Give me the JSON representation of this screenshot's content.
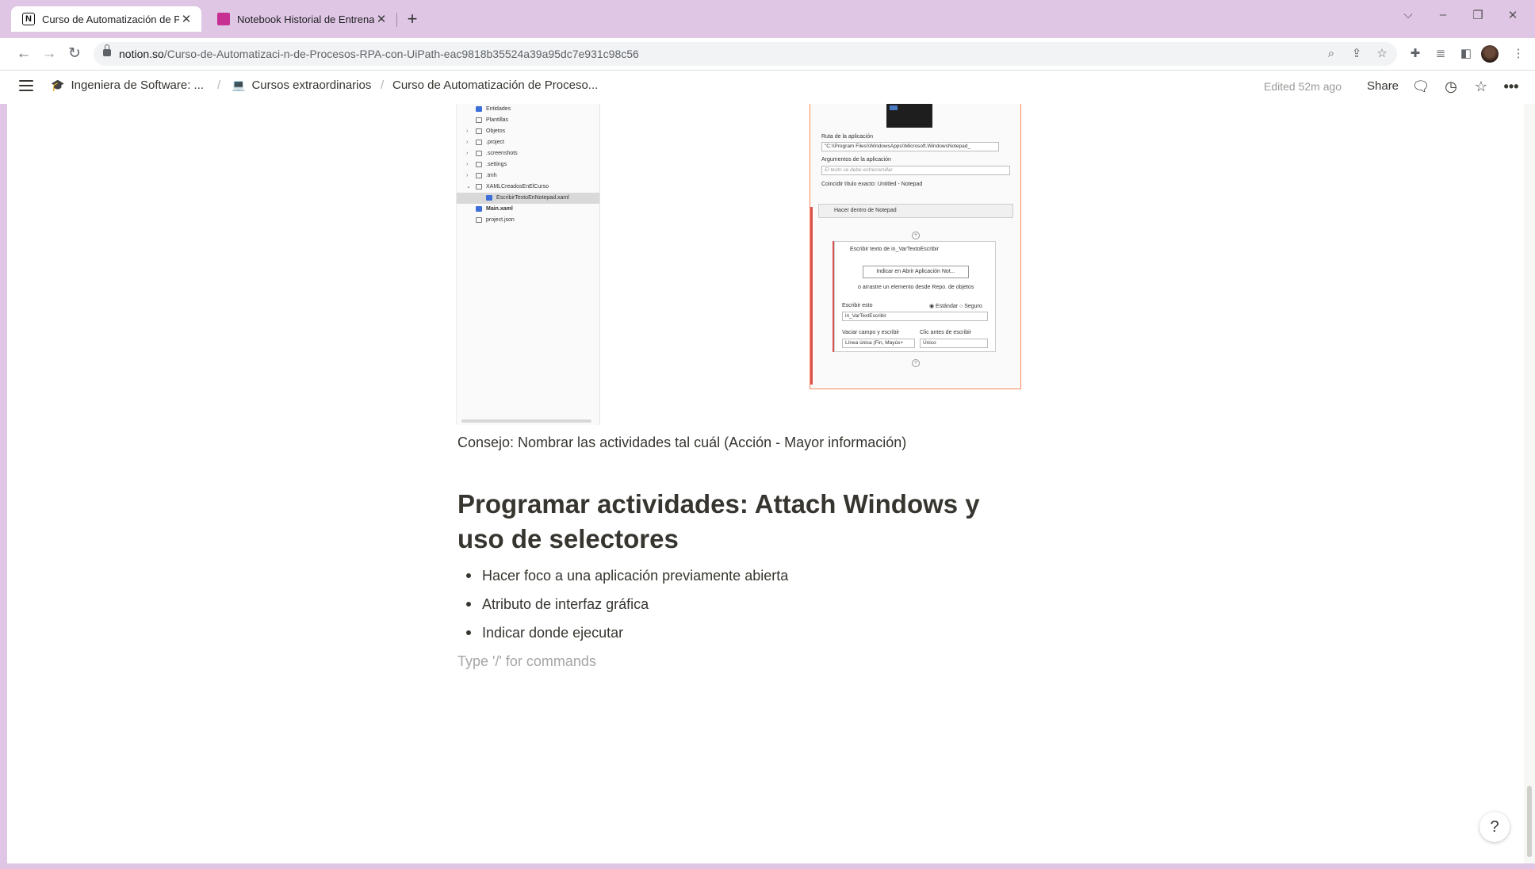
{
  "browser": {
    "tabs": [
      {
        "title": "Curso de Automatización de Proc",
        "active": true,
        "favicon": "notion-icon"
      },
      {
        "title": "Notebook Historial de Entrenami",
        "active": false,
        "favicon": "kaggle-icon"
      }
    ],
    "new_tab_symbol": "+",
    "window_controls": {
      "minimize": "–",
      "maximize": "❐",
      "close": "✕",
      "tab_search": "⌵"
    },
    "url_host": "notion.so",
    "url_path": "/Curso-de-Automatizaci-n-de-Procesos-RPA-con-UiPath-eac9818b35524a39a95dc7e931c98c56",
    "nav": {
      "back": "←",
      "forward": "→",
      "reload": "↻"
    },
    "toolbar_icons": [
      "zoom-icon",
      "share-page-icon",
      "bookmark-star-icon",
      "extensions-icon",
      "media-list-icon",
      "side-panel-icon",
      "avatar",
      "kebab-menu-icon"
    ]
  },
  "notion": {
    "breadcrumb": [
      {
        "icon": "🎓",
        "label": "Ingeniera de Software: ..."
      },
      {
        "icon": "💻",
        "label": "Cursos extraordinarios"
      },
      {
        "icon": "",
        "label": "Curso de Automatización de Proceso..."
      }
    ],
    "separator": "/",
    "edited": "Edited 52m ago",
    "share": "Share",
    "help": "?"
  },
  "screenshot_left": {
    "tree": [
      {
        "label": "Entidades",
        "depth": 1,
        "chevron": false
      },
      {
        "label": "Plantillas",
        "depth": 1,
        "chevron": false
      },
      {
        "label": "Objetos",
        "depth": 1,
        "chevron": true
      },
      {
        "label": ".project",
        "depth": 1,
        "chevron": true
      },
      {
        "label": ".screenshots",
        "depth": 1,
        "chevron": true
      },
      {
        "label": ".settings",
        "depth": 1,
        "chevron": true
      },
      {
        "label": ".tmh",
        "depth": 1,
        "chevron": true
      },
      {
        "label": "XAMLCreadosEnElCurso",
        "depth": 1,
        "chevron": true
      },
      {
        "label": "EscribirTextoEnNotepad.xaml",
        "depth": 2,
        "chevron": false,
        "selected": true
      },
      {
        "label": "Main.xaml",
        "depth": 1,
        "chevron": false,
        "bold": true
      },
      {
        "label": "project.json",
        "depth": 1,
        "chevron": false
      }
    ]
  },
  "screenshot_right": {
    "ruta_label": "Ruta de la aplicación",
    "ruta_value": "\"C:\\\\Program Files\\\\WindowsApps\\\\Microsoft.WindowsNotepad_",
    "args_label": "Argumentos de la aplicación",
    "args_placeholder": "El texto se debe entrecomillar",
    "coincidir": "Coincidir título exacto: Untitled - Notepad",
    "hacer_dentro": "Hacer dentro de Notepad",
    "escribir_texto": "Escribir texto de in_VarTextoEscribir",
    "indicar_btn": "Indicar en  Abrir Aplicación Not...",
    "arrastre": "o arrastre un elemento desde Repo. de objetos",
    "escribir_esto": "Escribir esto",
    "estandar": "◉ Estándar  ○ Seguro",
    "in_var": "in_VarTextEscribir",
    "vaciar": "Vaciar campo y escribir",
    "clic_antes": "Clic antes de escribir",
    "linea_unica": "Línea única (Fin, Mayús+",
    "unico": "Único"
  },
  "content": {
    "caption": "Consejo: Nombrar las actividades tal cuál (Acción - Mayor información)",
    "heading": "Programar actividades: Attach Windows y uso de selectores",
    "bullets": [
      "Hacer foco a una aplicación previamente abierta",
      "Atributo de interfaz gráfica",
      "Indicar donde ejecutar"
    ],
    "placeholder": "Type '/' for commands"
  },
  "colors": {
    "tabbar": "#dfc6e4",
    "text": "#37352f",
    "muted": "#9b9a97",
    "accent_border": "#ff8a5c"
  }
}
